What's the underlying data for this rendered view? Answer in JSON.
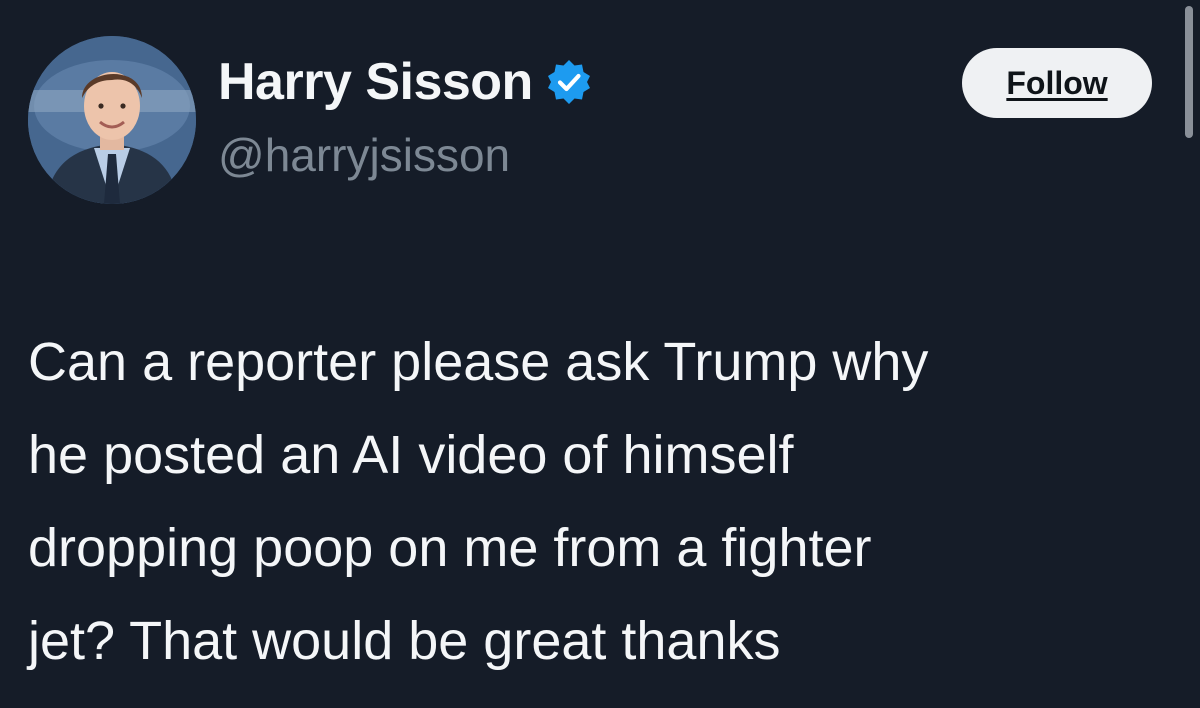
{
  "author": {
    "display_name": "Harry Sisson",
    "handle": "@harryjsisson",
    "verified": true,
    "verified_color": "#1d9bf0"
  },
  "follow_button": {
    "label": "Follow"
  },
  "tweet": {
    "lines": [
      "Can a reporter please ask Trump why",
      "he posted an AI video of himself",
      "dropping poop on me from a fighter",
      "jet? That would be great thanks"
    ]
  },
  "theme": {
    "background": "#151c28",
    "text": "#f4f6f8",
    "muted": "#7d8894"
  }
}
